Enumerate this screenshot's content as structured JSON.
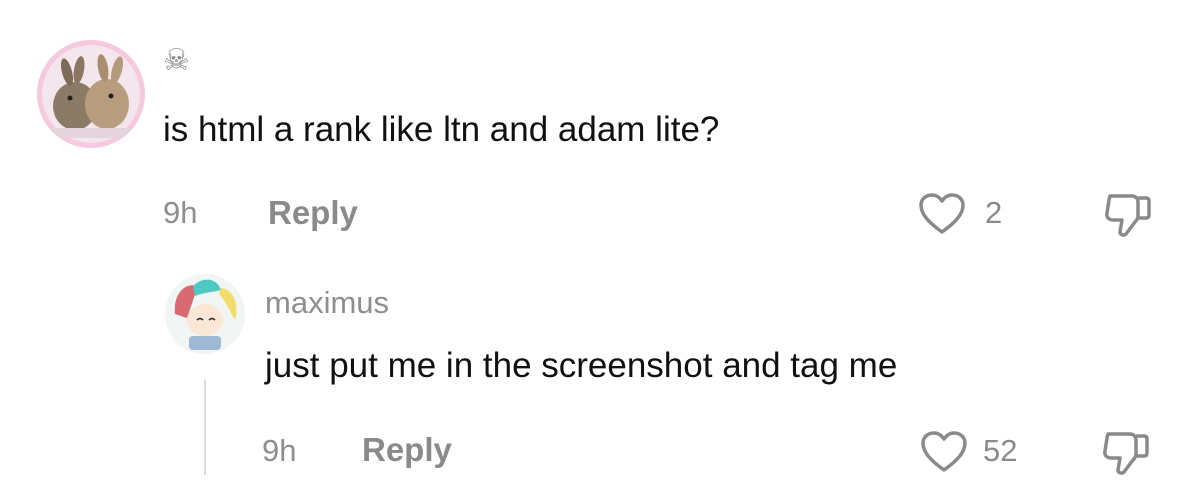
{
  "comments": [
    {
      "username": "☠",
      "text": "is html a rank like ltn and adam lite?",
      "time": "9h",
      "reply_label": "Reply",
      "likes": "2"
    },
    {
      "username": "maximus",
      "text": "just put me in the screenshot and tag me",
      "time": "9h",
      "reply_label": "Reply",
      "likes": "52"
    }
  ],
  "icons": {
    "like": "heart-outline-icon",
    "dislike": "thumbs-down-outline-icon"
  },
  "colors": {
    "muted_text": "#8e8e8e",
    "body_text": "#111111",
    "avatar_pink_border": "#f4c6dc"
  }
}
